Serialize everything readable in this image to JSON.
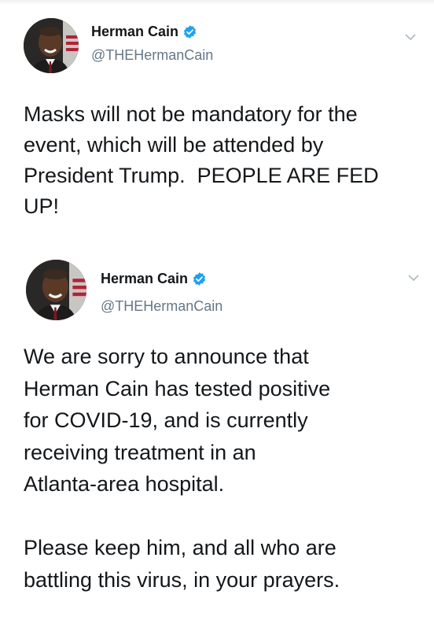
{
  "tweets": [
    {
      "author": {
        "name": "Herman Cain",
        "handle": "@THEHermanCain",
        "verified": true,
        "avatar_icon": "profile-photo"
      },
      "menu_icon": "chevron-down-icon",
      "text": "Masks will not be mandatory for the\nevent, which will be attended by\nPresident Trump.  PEOPLE ARE FED\nUP!"
    },
    {
      "author": {
        "name": "Herman Cain",
        "handle": "@THEHermanCain",
        "verified": true,
        "avatar_icon": "profile-photo"
      },
      "menu_icon": "chevron-down-icon",
      "text": "We are sorry to announce that\nHerman Cain has tested positive\nfor COVID-19, and is currently\nreceiving treatment in an\nAtlanta-area hospital.\n\nPlease keep him, and all who are\nbattling this virus, in your prayers."
    }
  ],
  "colors": {
    "text": "#14171a",
    "secondary_text": "#657786",
    "verified_badge": "#1da1f2",
    "chevron": "#aab8c2",
    "background": "#ffffff"
  }
}
